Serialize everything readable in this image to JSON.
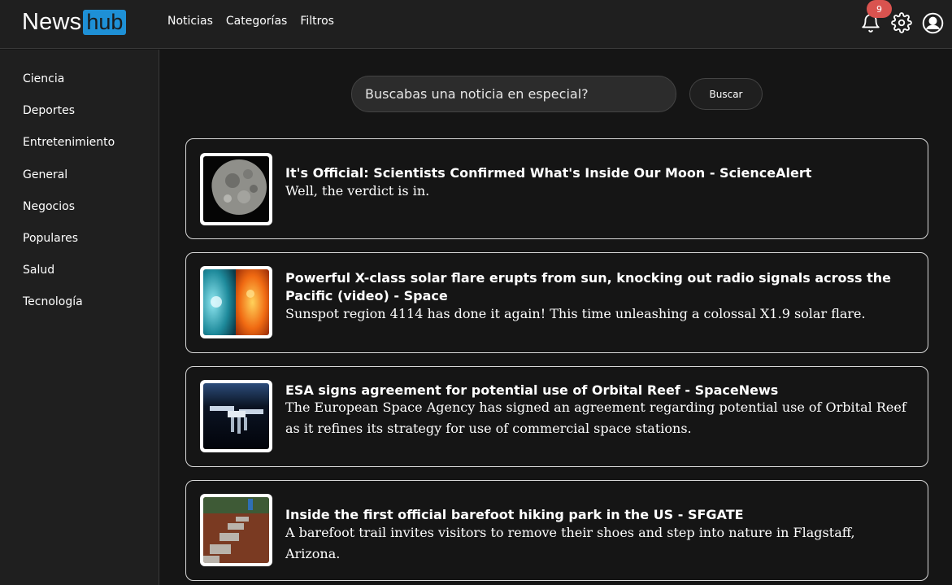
{
  "app": {
    "logo_left": "News",
    "logo_right": "hub"
  },
  "nav": {
    "items": [
      "Noticias",
      "Categorías",
      "Filtros"
    ]
  },
  "header": {
    "notification_count": "9",
    "icons": [
      "bell-icon",
      "gear-icon",
      "user-icon"
    ]
  },
  "sidebar": {
    "items": [
      "Ciencia",
      "Deportes",
      "Entretenimiento",
      "General",
      "Negocios",
      "Populares",
      "Salud",
      "Tecnología"
    ]
  },
  "search": {
    "placeholder": "Buscabas una noticia en especial?",
    "button_label": "Buscar"
  },
  "articles": [
    {
      "title": "It's Official: Scientists Confirmed What's Inside Our Moon - ScienceAlert",
      "description": "Well, the verdict is in.",
      "image": "moon-image"
    },
    {
      "title": "Powerful X-class solar flare erupts from sun, knocking out radio signals across the Pacific (video) - Space",
      "description": "Sunspot region 4114 has done it again! This time unleashing a colossal X1.9 solar flare.",
      "image": "solar-flare-image"
    },
    {
      "title": "ESA signs agreement for potential use of Orbital Reef - SpaceNews",
      "description": "The European Space Agency has signed an agreement regarding potential use of Orbital Reef as it refines its strategy for use of commercial space stations.",
      "image": "space-station-image"
    },
    {
      "title": "Inside the first official barefoot hiking park in the US - SFGATE",
      "description": "A barefoot trail invites visitors to remove their shoes and step into nature in Flagstaff, Arizona.",
      "image": "barefoot-trail-image"
    }
  ],
  "colors": {
    "accent": "#1e90d6",
    "badge": "#d9534f",
    "background": "#151515",
    "panel": "#1f1f1f"
  }
}
